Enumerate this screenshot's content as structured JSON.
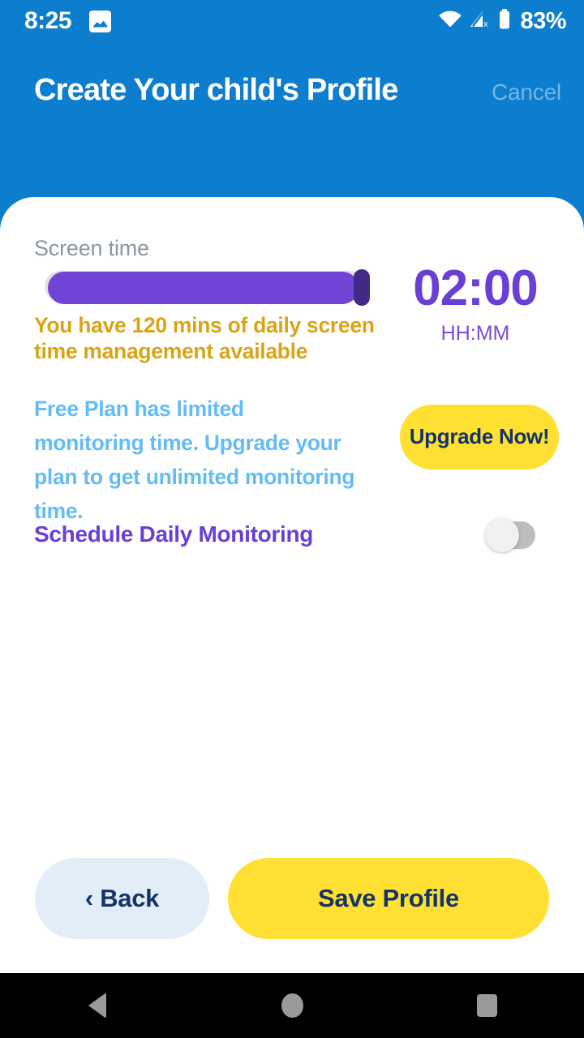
{
  "status_bar": {
    "time": "8:25",
    "battery_percent": "83%",
    "icons": [
      "photo-notification-icon",
      "wifi-icon",
      "cellular-no-sim-icon",
      "battery-icon"
    ]
  },
  "header": {
    "title": "Create Your child's Profile",
    "cancel_label": "Cancel",
    "background_color": "#0d7dcd"
  },
  "screen_time": {
    "section_label": "Screen time",
    "slider": {
      "value_percent": 97,
      "fill_color": "#7044d6",
      "thumb_color": "#3f2a86",
      "track_color": "#e2e2e4"
    },
    "timer_value": "02:00",
    "timer_format": "HH:MM",
    "timer_color": "#6a3fd4",
    "quota_text": "You have 120 mins of daily screen time management available",
    "quota_color": "#d9a416"
  },
  "upgrade": {
    "description": "Free Plan has limited monitoring time. Upgrade your plan to get unlimited monitoring time.",
    "description_color": "#63bcf5",
    "button_label": "Upgrade Now!",
    "button_color": "#ffe033"
  },
  "schedule": {
    "label": "Schedule Daily Monitoring",
    "label_color": "#6a3fd4",
    "toggle_state": "off"
  },
  "footer": {
    "back_label": "‹ Back",
    "back_color": "#e3edf8",
    "save_label": "Save Profile",
    "save_color": "#ffe033",
    "text_color": "#143567"
  },
  "nav_bar": {
    "back_icon": "triangle-back-icon",
    "home_icon": "circle-home-icon",
    "recents_icon": "square-recents-icon"
  }
}
